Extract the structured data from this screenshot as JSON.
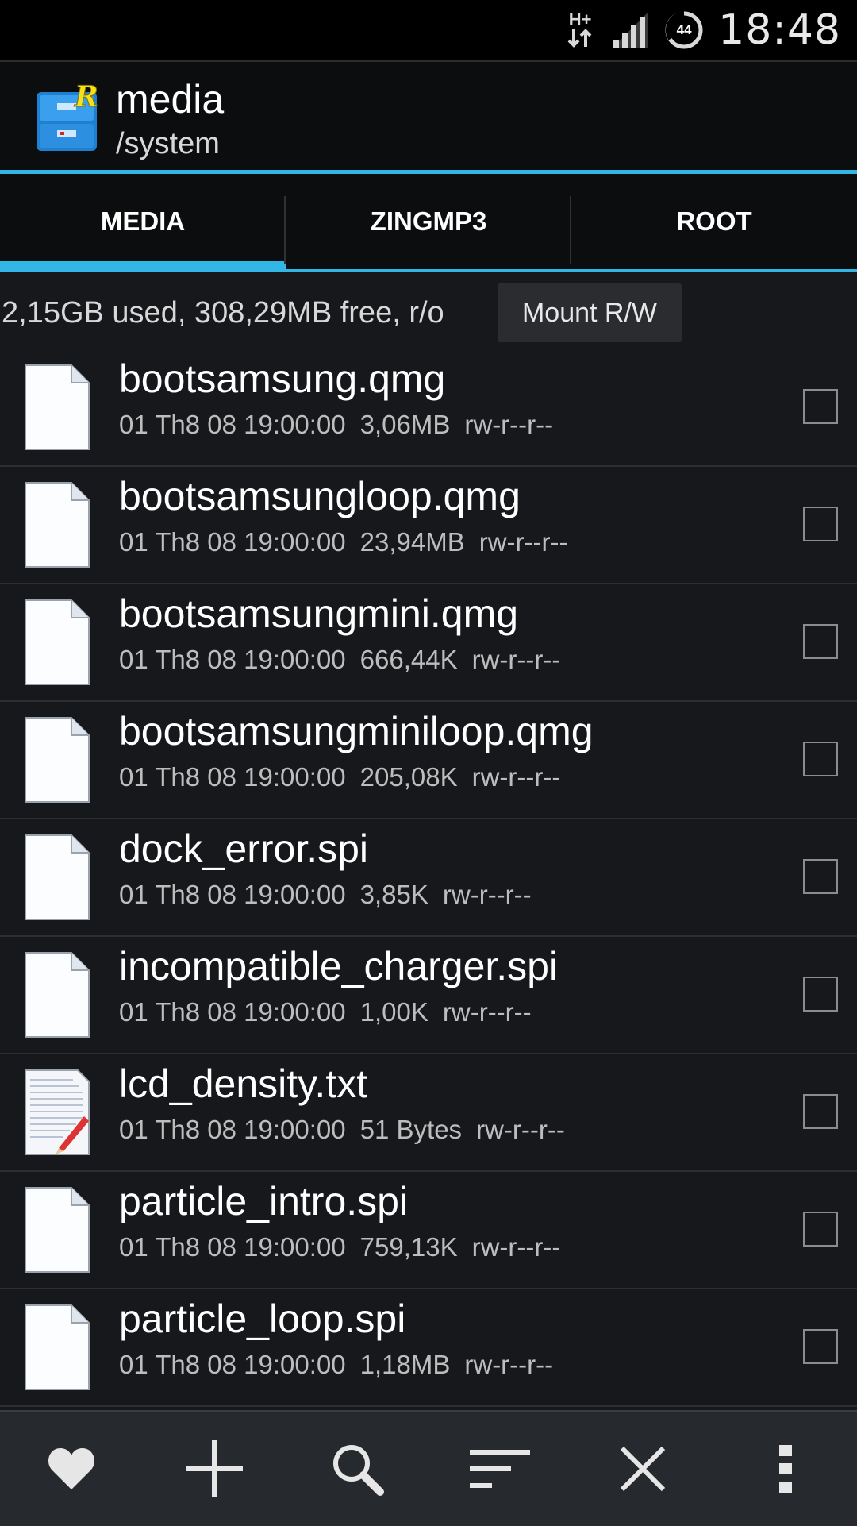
{
  "status_bar": {
    "network_type": "H+",
    "battery_level": "44",
    "time": "18:48",
    "icons": [
      "data-arrows-icon",
      "signal-icon",
      "battery-icon"
    ]
  },
  "action_bar": {
    "title": "media",
    "subtitle": "/system",
    "accent_color": "#33b5e5"
  },
  "tabs": [
    {
      "label": "MEDIA",
      "active": true
    },
    {
      "label": "ZINGMP3",
      "active": false
    },
    {
      "label": "ROOT",
      "active": false
    }
  ],
  "info": {
    "usage_text": "2,15GB used, 308,29MB free, r/o",
    "mount_button_label": "Mount R/W"
  },
  "files": [
    {
      "name": "bootsamsung.qmg",
      "date": "01 Th8 08 19:00:00",
      "size": "3,06MB",
      "perms": "rw-r--r--",
      "icon": "file-icon"
    },
    {
      "name": "bootsamsungloop.qmg",
      "date": "01 Th8 08 19:00:00",
      "size": "23,94MB",
      "perms": "rw-r--r--",
      "icon": "file-icon"
    },
    {
      "name": "bootsamsungmini.qmg",
      "date": "01 Th8 08 19:00:00",
      "size": "666,44K",
      "perms": "rw-r--r--",
      "icon": "file-icon"
    },
    {
      "name": "bootsamsungminiloop.qmg",
      "date": "01 Th8 08 19:00:00",
      "size": "205,08K",
      "perms": "rw-r--r--",
      "icon": "file-icon"
    },
    {
      "name": "dock_error.spi",
      "date": "01 Th8 08 19:00:00",
      "size": "3,85K",
      "perms": "rw-r--r--",
      "icon": "file-icon"
    },
    {
      "name": "incompatible_charger.spi",
      "date": "01 Th8 08 19:00:00",
      "size": "1,00K",
      "perms": "rw-r--r--",
      "icon": "file-icon"
    },
    {
      "name": "lcd_density.txt",
      "date": "01 Th8 08 19:00:00",
      "size": "51 Bytes",
      "perms": "rw-r--r--",
      "icon": "text-file-icon"
    },
    {
      "name": "particle_intro.spi",
      "date": "01 Th8 08 19:00:00",
      "size": "759,13K",
      "perms": "rw-r--r--",
      "icon": "file-icon"
    },
    {
      "name": "particle_loop.spi",
      "date": "01 Th8 08 19:00:00",
      "size": "1,18MB",
      "perms": "rw-r--r--",
      "icon": "file-icon"
    }
  ],
  "bottom_bar": [
    "heart-icon",
    "plus-icon",
    "search-icon",
    "sort-icon",
    "close-icon",
    "overflow-menu-icon"
  ]
}
